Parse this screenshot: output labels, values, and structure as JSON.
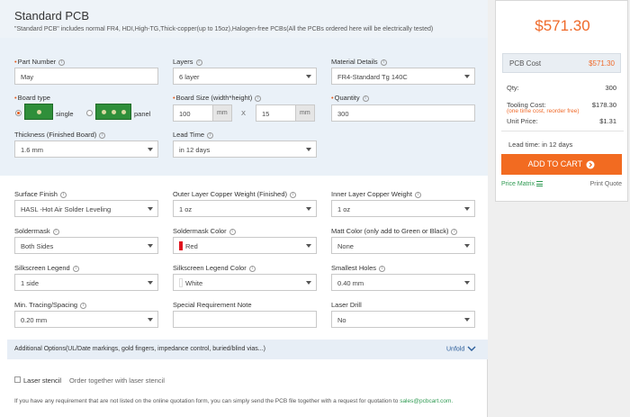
{
  "header": {
    "title": "Standard PCB",
    "subtitle": "\"Standard PCB\" includes normal FR4, HDI,High-TG,Thick-copper(up to 15oz),Halogen-free PCBs(All the PCBs ordered here will be electrically tested)"
  },
  "fields": {
    "part_number": {
      "label": "Part Number",
      "value": "May"
    },
    "layers": {
      "label": "Layers",
      "value": "6 layer"
    },
    "material": {
      "label": "Material Details",
      "value": "FR4-Standard Tg 140C"
    },
    "board_type": {
      "label": "Board type",
      "opt_single": "single",
      "opt_panel": "panel"
    },
    "board_size": {
      "label": "Board Size (width*height)",
      "width": "100",
      "height": "15",
      "unit": "mm",
      "sep": "X"
    },
    "quantity": {
      "label": "Quantity",
      "value": "300"
    },
    "thickness": {
      "label": "Thickness (Finished Board)",
      "value": "1.6 mm"
    },
    "lead_time": {
      "label": "Lead Time",
      "value": "in 12 days"
    },
    "surface_finish": {
      "label": "Surface Finish",
      "value": "HASL -Hot Air Solder Leveling"
    },
    "outer_copper": {
      "label": "Outer Layer Copper Weight (Finished)",
      "value": "1 oz"
    },
    "inner_copper": {
      "label": "Inner Layer Copper Weight",
      "value": "1 oz"
    },
    "soldermask": {
      "label": "Soldermask",
      "value": "Both Sides"
    },
    "soldermask_color": {
      "label": "Soldermask Color",
      "value": "Red",
      "swatch": "#e0141e"
    },
    "matt_color": {
      "label": "Matt Color (only add to Green or Black)",
      "value": "None"
    },
    "silkscreen": {
      "label": "Silkscreen Legend",
      "value": "1 side"
    },
    "silkscreen_color": {
      "label": "Silkscreen Legend Color",
      "value": "White",
      "swatch": "#ffffff"
    },
    "smallest_holes": {
      "label": "Smallest Holes",
      "value": "0.40 mm"
    },
    "min_tracing": {
      "label": "Min. Tracing/Spacing",
      "value": "0.20 mm"
    },
    "special_note": {
      "label": "Special Requirement Note",
      "value": ""
    },
    "laser_drill": {
      "label": "Laser Drill",
      "value": "No"
    }
  },
  "additional": {
    "text": "Additional Options(UL/Date markings, gold fingers, impedance control, buried/blind vias...)",
    "unfold": "Unfold"
  },
  "stencil": {
    "label": "Laser stencil",
    "note": "Order together with laser stencil"
  },
  "footer": {
    "text": "If you have any requirement that are not listed on the online quotation form, you can simply send the PCB file together with a request for quotation to",
    "email": "sales@pcbcart.com."
  },
  "sidebar": {
    "total": "$571.30",
    "pcb_cost_label": "PCB Cost",
    "pcb_cost_value": "$571.30",
    "qty_label": "Qty:",
    "qty_value": "300",
    "tooling_label": "Tooling Cost:",
    "tooling_value": "$178.30",
    "tooling_note": "(one time cost, reorder free)",
    "unit_label": "Unit Price:",
    "unit_value": "$1.31",
    "lead_time": "Lead time: in 12 days",
    "add_to_cart": "ADD TO CART",
    "price_matrix": "Price Matrix",
    "print_quote": "Print Quote"
  },
  "colors": {
    "accent": "#f26b21",
    "price": "#ef6a2a",
    "link": "#2f9a52",
    "required": "#e35a1c"
  }
}
